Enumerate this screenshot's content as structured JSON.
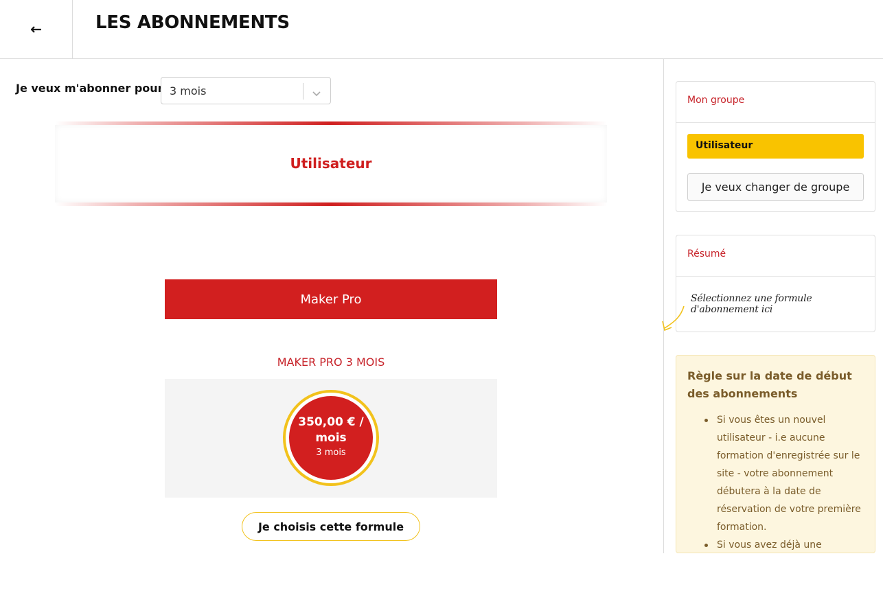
{
  "header": {
    "back_icon": "back-arrow-icon",
    "title": "LES ABONNEMENTS"
  },
  "subscribe": {
    "label": "Je veux m'abonner pour",
    "selected": "3 mois"
  },
  "group_banner": {
    "label": "Utilisateur"
  },
  "plan": {
    "header": "Maker Pro",
    "name": "MAKER PRO 3 MOIS",
    "price": "350,00 € / mois",
    "duration": "3 mois",
    "choose_label": "Je choisis cette formule"
  },
  "sidebar": {
    "group_card": {
      "title": "Mon groupe",
      "badge": "Utilisateur",
      "change_label": "Je veux changer de groupe"
    },
    "summary_card": {
      "title": "Résumé",
      "text": "Sélectionnez une formule d'abonnement ici"
    },
    "rule": {
      "title": "Règle sur la date de début des abonnements",
      "items": [
        "Si vous êtes un nouvel utilisateur - i.e aucune formation d'enregistrée sur le site - votre abonnement débutera à la date de réservation de votre première formation.",
        "Si vous avez déjà une"
      ]
    }
  },
  "colors": {
    "accent_red": "#d21f1f",
    "gold": "#f2c21c",
    "badge_yellow": "#f9c300",
    "rule_bg": "#fdf6df",
    "rule_text": "#7a5c2a"
  }
}
